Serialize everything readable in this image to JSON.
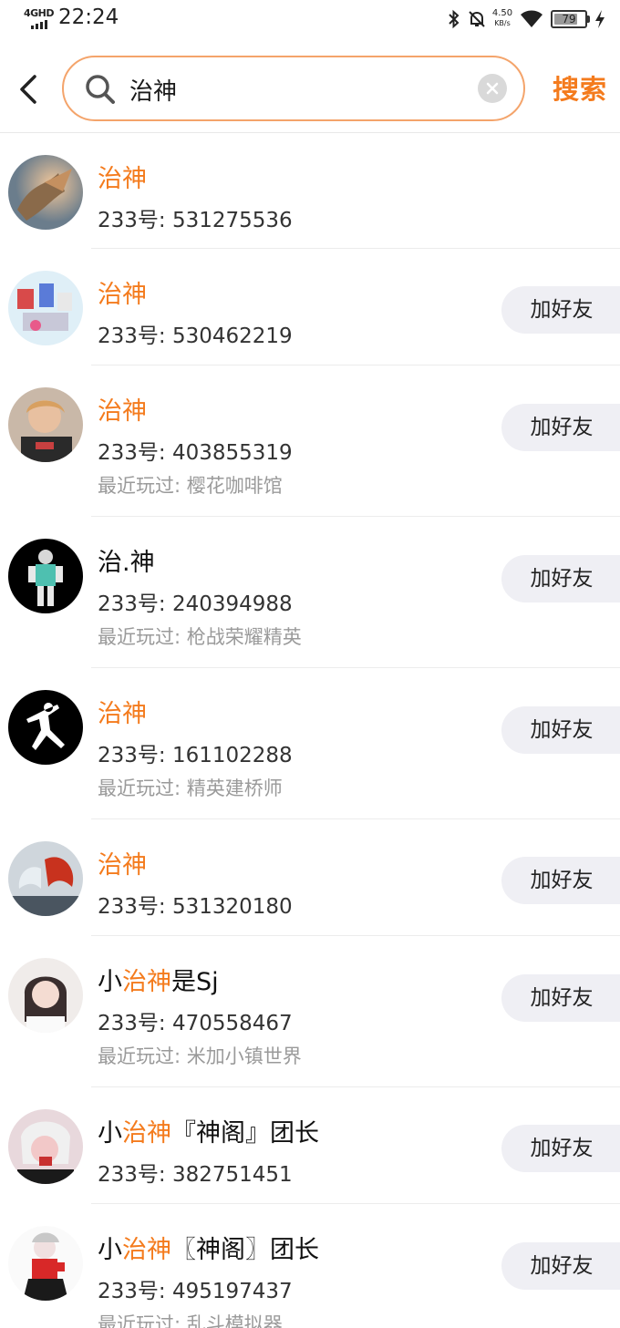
{
  "status_bar": {
    "network": "4GHD",
    "time": "22:24",
    "speed_value": "4.50",
    "speed_unit": "KB/s",
    "battery": "79",
    "battery_level": 0.79
  },
  "search": {
    "query": "治神",
    "submit_label": "搜索",
    "accent_color": "#f47b1d",
    "border_color": "#f4a46b"
  },
  "results": [
    {
      "name_parts": [
        {
          "text": "治神",
          "highlight": true
        }
      ],
      "id_text": "233号: 531275536",
      "show_add": false,
      "avatar": "dragon-avatar"
    },
    {
      "name_parts": [
        {
          "text": "治神",
          "highlight": true
        }
      ],
      "id_text": "233号: 530462219",
      "add_label": "加好友",
      "show_add": true,
      "avatar": "game-scene-avatar"
    },
    {
      "name_parts": [
        {
          "text": "治神",
          "highlight": true
        }
      ],
      "id_text": "233号: 403855319",
      "recent_text": "最近玩过: 樱花咖啡馆",
      "add_label": "加好友",
      "show_add": true,
      "avatar": "boy-portrait-avatar"
    },
    {
      "name_parts": [
        {
          "text": "治.神",
          "highlight": false
        }
      ],
      "id_text": "233号: 240394988",
      "recent_text": "最近玩过: 枪战荣耀精英",
      "add_label": "加好友",
      "show_add": true,
      "avatar": "character-avatar"
    },
    {
      "name_parts": [
        {
          "text": "治神",
          "highlight": true
        }
      ],
      "id_text": "233号: 161102288",
      "recent_text": "最近玩过: 精英建桥师",
      "add_label": "加好友",
      "show_add": true,
      "avatar": "jumpman-avatar"
    },
    {
      "name_parts": [
        {
          "text": "治神",
          "highlight": true
        }
      ],
      "id_text": "233号: 531320180",
      "add_label": "加好友",
      "show_add": true,
      "avatar": "phoenix-avatar"
    },
    {
      "name_parts": [
        {
          "text": "小",
          "highlight": false
        },
        {
          "text": "治神",
          "highlight": true
        },
        {
          "text": "是Sj",
          "highlight": false
        }
      ],
      "id_text": "233号: 470558467",
      "recent_text": "最近玩过: 米加小镇世界",
      "add_label": "加好友",
      "show_add": true,
      "avatar": "girl-portrait-avatar"
    },
    {
      "name_parts": [
        {
          "text": "小",
          "highlight": false
        },
        {
          "text": "治神",
          "highlight": true
        },
        {
          "text": "『神阁』团长",
          "highlight": false
        }
      ],
      "id_text": "233号: 382751451",
      "add_label": "加好友",
      "show_add": true,
      "avatar": "pink-portrait-avatar"
    },
    {
      "name_parts": [
        {
          "text": "小",
          "highlight": false
        },
        {
          "text": "治神",
          "highlight": true
        },
        {
          "text": "〖神阁〗团长",
          "highlight": false
        }
      ],
      "id_text": "233号: 495197437",
      "recent_text": "最近玩过: 乱斗模拟器",
      "add_label": "加好友",
      "show_add": true,
      "avatar": "anime-avatar"
    }
  ]
}
